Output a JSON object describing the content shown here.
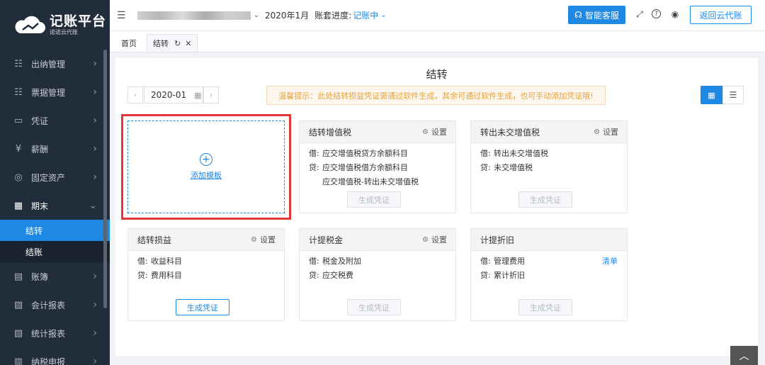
{
  "app": {
    "logo_title": "记账平台",
    "logo_subtitle": "诺诺云代账"
  },
  "sidebar": {
    "items": [
      {
        "label": "出纳管理",
        "icon": "cashier-icon"
      },
      {
        "label": "票据管理",
        "icon": "invoice-icon"
      },
      {
        "label": "凭证",
        "icon": "voucher-icon"
      },
      {
        "label": "薪酬",
        "icon": "salary-icon"
      },
      {
        "label": "固定资产",
        "icon": "asset-icon"
      },
      {
        "label": "期末",
        "icon": "calendar-icon",
        "open": true,
        "children": [
          {
            "label": "结转",
            "active": true
          },
          {
            "label": "结账"
          }
        ]
      },
      {
        "label": "账簿",
        "icon": "ledger-icon"
      },
      {
        "label": "会计报表",
        "icon": "report-icon"
      },
      {
        "label": "统计报表",
        "icon": "stats-icon"
      },
      {
        "label": "纳税申报",
        "icon": "tax-icon"
      }
    ]
  },
  "header": {
    "period": "2020年1月",
    "progress_label": "账套进度:",
    "progress_value": "记账中",
    "service_label": "智能客服",
    "return_label": "返回云代账"
  },
  "tabs": {
    "home": "首页",
    "active": "结转"
  },
  "main": {
    "title": "结转",
    "date_value": "2020-01",
    "tip": "温馨提示：此处结转损益凭证需通过软件生成，其余可通过软件生成，也可手动添加凭证哦!",
    "add_template": "添加模板",
    "setting_label": "设置",
    "generate_label": "生成凭证",
    "detail_label": "清单",
    "cards": [
      {
        "title": "结转增值税",
        "lines": [
          [
            "借:",
            "应交增值税贷方余额科目"
          ],
          [
            "贷:",
            "应交增值税借方余额科目"
          ],
          [
            "",
            "应交增值税-转出未交增值税"
          ]
        ],
        "enabled": false
      },
      {
        "title": "转出未交增值税",
        "lines": [
          [
            "借:",
            "转出未交增值税"
          ],
          [
            "贷:",
            "未交增值税"
          ]
        ],
        "enabled": false
      },
      {
        "title": "结转损益",
        "lines": [
          [
            "借:",
            "收益科目"
          ],
          [
            "贷:",
            "费用科目"
          ]
        ],
        "enabled": true
      },
      {
        "title": "计提税金",
        "lines": [
          [
            "借:",
            "税金及附加"
          ],
          [
            "贷:",
            "应交税费"
          ]
        ],
        "enabled": false
      },
      {
        "title": "计提折旧",
        "lines": [
          [
            "借:",
            "管理费用"
          ],
          [
            "贷:",
            "累计折旧"
          ]
        ],
        "enabled": false
      }
    ]
  }
}
